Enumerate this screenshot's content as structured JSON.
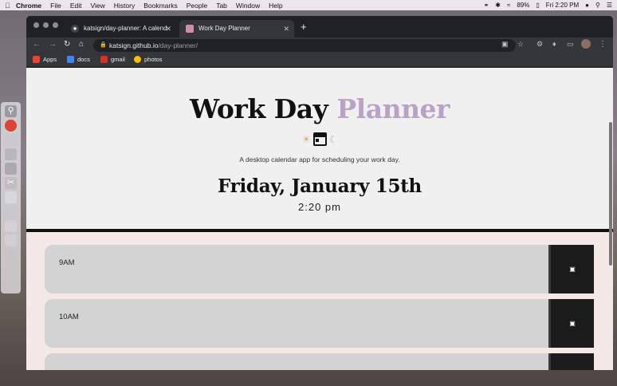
{
  "menubar": {
    "apple": "",
    "app_name": "Chrome",
    "items": [
      "File",
      "Edit",
      "View",
      "History",
      "Bookmarks",
      "People",
      "Tab",
      "Window",
      "Help"
    ],
    "battery": "89%",
    "clock": "Fri 2:20 PM"
  },
  "browser": {
    "tabs": [
      {
        "title": "katsign/day-planner: A calend",
        "icon": "github-icon"
      },
      {
        "title": "Work Day Planner",
        "icon": "calendar-favicon-icon"
      }
    ],
    "url_host": "katsign.github.io",
    "url_path": "/day-planner/",
    "bookmarks": [
      {
        "label": "Apps",
        "color": "#ea4335"
      },
      {
        "label": "docs",
        "color": "#4285f4"
      },
      {
        "label": "gmail",
        "color": "#d93025"
      },
      {
        "label": "photos",
        "color": "#fbbc04"
      }
    ]
  },
  "page": {
    "title_main": "Work Day",
    "title_accent": "Planner",
    "accent_color": "#b8a3c6",
    "tagline": "A desktop calendar app for scheduling your work day.",
    "date": "Friday, January 15th",
    "time": "2:20 pm",
    "hours": [
      {
        "label": "9AM"
      },
      {
        "label": "10AM"
      },
      {
        "label": ""
      }
    ]
  }
}
